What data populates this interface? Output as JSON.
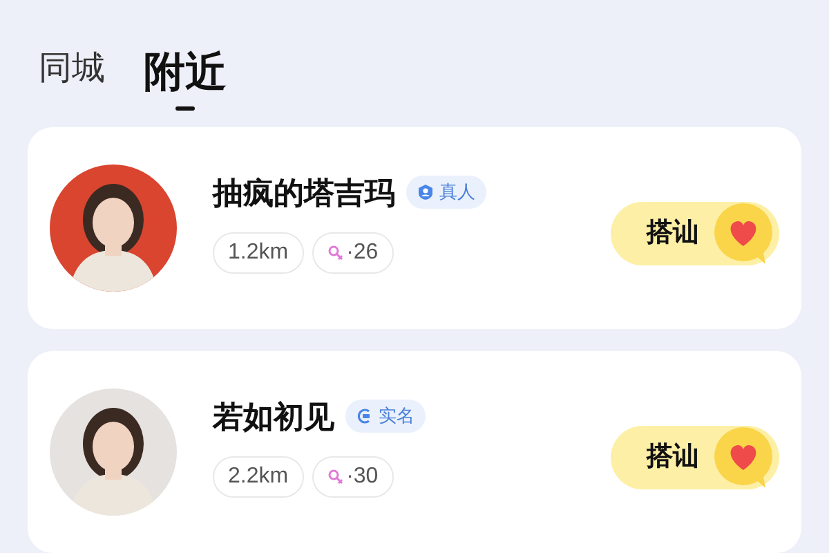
{
  "tabs": [
    {
      "label": "同城",
      "selected": false
    },
    {
      "label": "附近",
      "selected": true
    }
  ],
  "users": [
    {
      "name": "抽疯的塔吉玛",
      "badge": {
        "kind": "real_person",
        "label": "真人"
      },
      "distance": "1.2km",
      "age": "·26",
      "action": "搭讪"
    },
    {
      "name": "若如初见",
      "badge": {
        "kind": "real_name",
        "label": "实名"
      },
      "distance": "2.2km",
      "age": "·30",
      "action": "搭讪"
    }
  ]
}
